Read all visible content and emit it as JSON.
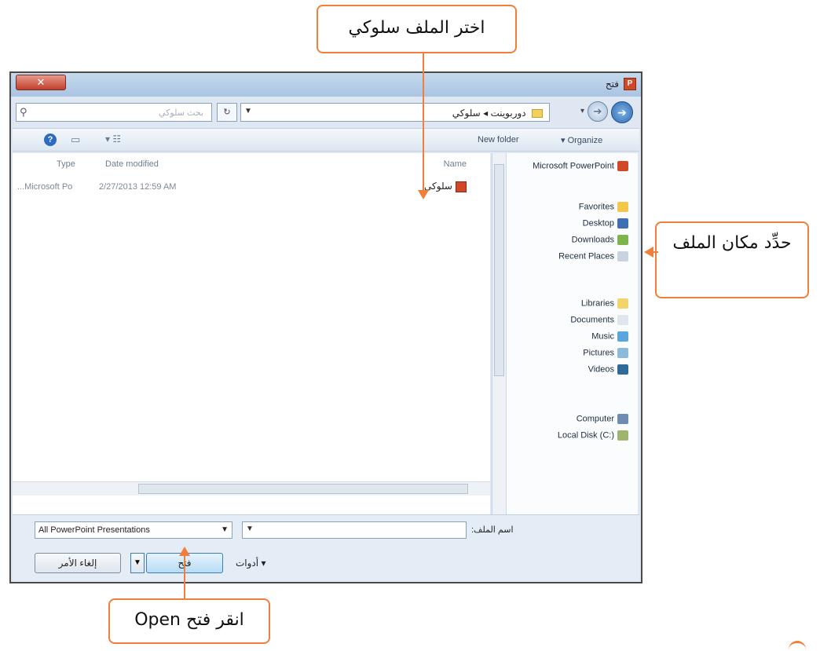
{
  "dialog": {
    "title": "فتح",
    "close_label": "✕",
    "address": {
      "breadcrumb": [
        "سلوكي",
        "دوربوينت"
      ],
      "search_placeholder": "بحث سلوكي"
    },
    "toolbar": {
      "new_folder": "New folder",
      "organize": "▾ Organize"
    },
    "nav_pane": {
      "items": [
        {
          "label": "Microsoft PowerPoint",
          "icon": "powerpoint-icon"
        },
        {
          "label": "Favorites",
          "icon": "star-icon"
        },
        {
          "label": "Desktop",
          "icon": "desktop-icon"
        },
        {
          "label": "Downloads",
          "icon": "downloads-icon"
        },
        {
          "label": "Recent Places",
          "icon": "recent-places-icon"
        },
        {
          "label": "Libraries",
          "icon": "libraries-icon"
        },
        {
          "label": "Documents",
          "icon": "documents-icon"
        },
        {
          "label": "Music",
          "icon": "music-icon"
        },
        {
          "label": "Pictures",
          "icon": "pictures-icon"
        },
        {
          "label": "Videos",
          "icon": "videos-icon"
        },
        {
          "label": "Computer",
          "icon": "computer-icon"
        },
        {
          "label": "Local Disk (C:)",
          "icon": "disk-icon"
        }
      ]
    },
    "file_list": {
      "columns": {
        "name": "Name",
        "date": "Date modified",
        "type": "Type"
      },
      "rows": [
        {
          "name": "سلوكي",
          "date": "2/27/2013 12:59 AM",
          "type": "...Microsoft Po"
        }
      ]
    },
    "bottom": {
      "filename_label": "اسم الملف:",
      "filetype_value": "All PowerPoint Presentations",
      "tools_label": "أدوات",
      "open_label": "فتح",
      "cancel_label": "إلغاء الأمر"
    }
  },
  "callouts": {
    "select_file": "اختر الملف سلوكي",
    "choose_location": "حدِّد مكان الملف",
    "click_open": "انقر فتح Open"
  },
  "colors": {
    "callout_border": "#f07f3c",
    "arrow": "#f07f3c"
  }
}
